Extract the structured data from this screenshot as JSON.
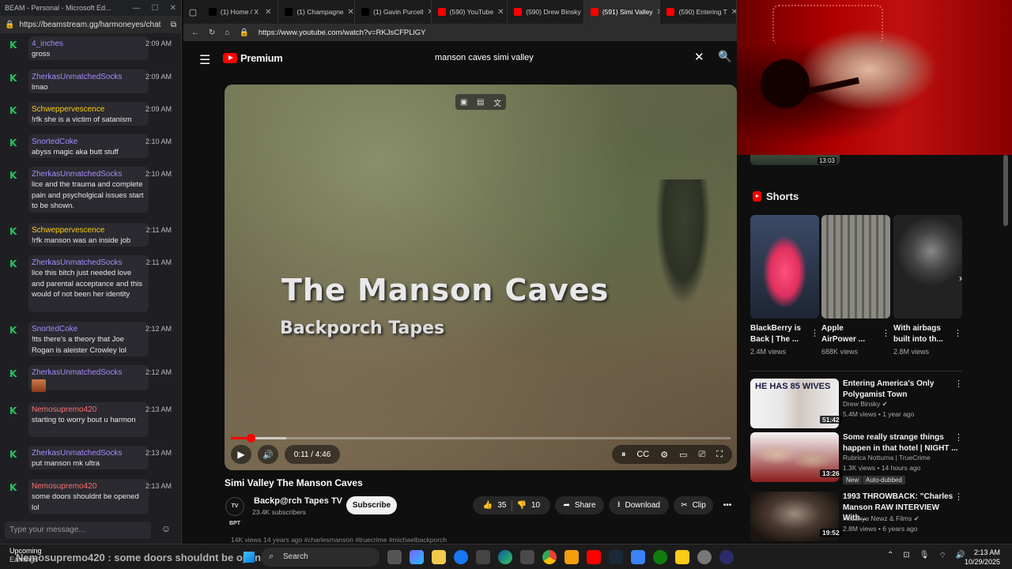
{
  "chat": {
    "window_title": "BEAM - Personal - Microsoft Ed...",
    "url": "https://beamstream.gg/harmoneyes/chat",
    "messages": [
      {
        "user": "4_inches",
        "color": "#a78bfa",
        "text": "gross",
        "time": "2:09 AM"
      },
      {
        "user": "ZherkasUnmatchedSocks",
        "color": "#a78bfa",
        "text": "lmao",
        "time": "2:09 AM"
      },
      {
        "user": "Schweppervescence",
        "color": "#facc15",
        "text": "!rfk she is a victim of satanism",
        "time": "2:09 AM"
      },
      {
        "user": "SnortedCoke",
        "color": "#a78bfa",
        "text": "abyss magic aka butt stuff",
        "time": "2:10 AM"
      },
      {
        "user": "ZherkasUnmatchedSocks",
        "color": "#a78bfa",
        "text": "lice and the trauma and complete pain and psycholgical issues start to be shown.",
        "time": "2:10 AM"
      },
      {
        "user": "Schweppervescence",
        "color": "#facc15",
        "text": "!rfk manson was an inside job",
        "time": "2:11 AM"
      },
      {
        "user": "ZherkasUnmatchedSocks",
        "color": "#a78bfa",
        "text": "lice this bitch just needed love and parental acceptance and this would of not been her identity",
        "time": "2:11 AM"
      },
      {
        "user": "SnortedCoke",
        "color": "#a78bfa",
        "text": "!tts there's a theory that Joe Rogan is aleister Crowley lol",
        "time": "2:12 AM"
      },
      {
        "user": "ZherkasUnmatchedSocks",
        "color": "#a78bfa",
        "text": "",
        "time": "2:12 AM",
        "emote": true
      },
      {
        "user": "Nemosupremo420",
        "color": "#f87171",
        "text": "starting to worry bout u harmon",
        "time": "2:13 AM"
      },
      {
        "user": "ZherkasUnmatchedSocks",
        "color": "#a78bfa",
        "text": "put manson mk ultra",
        "time": "2:13 AM"
      },
      {
        "user": "Nemosupremo420",
        "color": "#f87171",
        "text": "some doors shouldnt be opened lol",
        "time": "2:13 AM"
      }
    ],
    "input_placeholder": "Type your message..."
  },
  "browser": {
    "tabs": [
      {
        "label": "(1) Home / X",
        "fav": "#000000"
      },
      {
        "label": "(1) Champagne",
        "fav": "#000000"
      },
      {
        "label": "(1) Gavin Purcell",
        "fav": "#000000"
      },
      {
        "label": "(590) YouTube",
        "fav": "#ff0000"
      },
      {
        "label": "(590) Drew Binsky",
        "fav": "#ff0000"
      },
      {
        "label": "(591) Simi Valley",
        "fav": "#ff0000",
        "active": true
      },
      {
        "label": "(590) Entering T",
        "fav": "#ff0000"
      }
    ],
    "url": "https://www.youtube.com/watch?v=RKJsCFPLlGY"
  },
  "youtube": {
    "logo_text": "Premium",
    "search_query": "manson caves simi valley",
    "video": {
      "overlay_title": "The Manson Caves",
      "overlay_subtitle": "Backporch Tapes",
      "time": "0:11 / 4:46",
      "progress_fraction": 0.04,
      "buffered_fraction": 0.11,
      "title": "Simi Valley The Manson Caves",
      "channel": "Backp@rch Tapes TV",
      "channel_avatar_text": "TV BPT",
      "subscribers": "23.4K subscribers",
      "subscribe_label": "Subscribe",
      "likes": "35",
      "dislikes": "10",
      "share_label": "Share",
      "download_label": "Download",
      "clip_label": "Clip",
      "description_peek": "14K views  14 years ago  #charlesmanson #truecrime #michaelbackporch"
    },
    "prev_thumb_duration": "13:03",
    "shorts": {
      "heading": "Shorts",
      "items": [
        {
          "title": "BlackBerry is Back | The ...",
          "views": "2.4M views"
        },
        {
          "title": "Apple AirPower ...",
          "views": "688K views"
        },
        {
          "title": "With airbags built into th...",
          "views": "2.8M views"
        }
      ]
    },
    "recommendations": [
      {
        "title": "Entering America's Only Polygamist Town",
        "channel": "Drew Binsky ✔",
        "meta": "5.4M views • 1 year ago",
        "duration": "51:42",
        "thumb_text": "HE HAS 85 WIVES"
      },
      {
        "title": "Some really strange things happen in that hotel | NIGHT ...",
        "channel": "Rubrica Notturna | TrueCrime",
        "meta": "1.3K views • 14 hours ago",
        "duration": "13:26",
        "badge": "New",
        "badge2": "Auto-dubbed"
      },
      {
        "title": "1993 THROWBACK: \"Charles Manson RAW INTERVIEW With...",
        "channel": "Hezakya Newz & Films ✔",
        "meta": "2.8M views • 6 years ago",
        "duration": "19:52"
      }
    ]
  },
  "taskbar": {
    "weather_line1": "Upcoming",
    "weather_line2": "Earnings",
    "caption_overlay": "Nemosupremo420 : some doors shouldnt be opened lol",
    "search_label": "Search",
    "time": "2:13 AM",
    "date": "10/29/2025"
  }
}
